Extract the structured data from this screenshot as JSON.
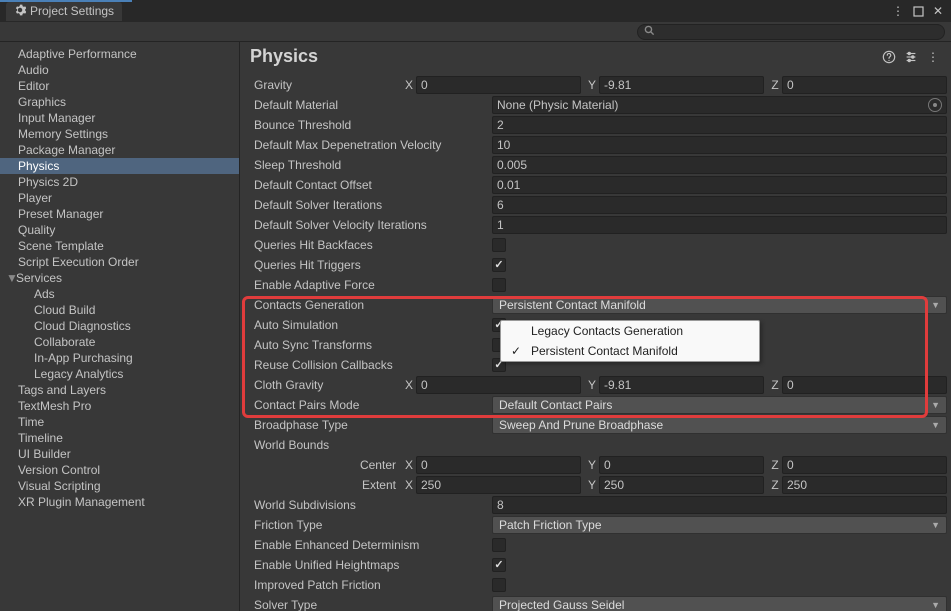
{
  "window": {
    "title": "Project Settings"
  },
  "search": {
    "placeholder": ""
  },
  "sidebar": {
    "items": [
      {
        "label": "Adaptive Performance"
      },
      {
        "label": "Audio"
      },
      {
        "label": "Editor"
      },
      {
        "label": "Graphics"
      },
      {
        "label": "Input Manager"
      },
      {
        "label": "Memory Settings"
      },
      {
        "label": "Package Manager"
      },
      {
        "label": "Physics",
        "selected": true
      },
      {
        "label": "Physics 2D"
      },
      {
        "label": "Player"
      },
      {
        "label": "Preset Manager"
      },
      {
        "label": "Quality"
      },
      {
        "label": "Scene Template"
      },
      {
        "label": "Script Execution Order"
      },
      {
        "label": "Services",
        "expandable": true,
        "expanded": true
      },
      {
        "label": "Ads",
        "indent": true
      },
      {
        "label": "Cloud Build",
        "indent": true
      },
      {
        "label": "Cloud Diagnostics",
        "indent": true
      },
      {
        "label": "Collaborate",
        "indent": true
      },
      {
        "label": "In-App Purchasing",
        "indent": true
      },
      {
        "label": "Legacy Analytics",
        "indent": true
      },
      {
        "label": "Tags and Layers"
      },
      {
        "label": "TextMesh Pro"
      },
      {
        "label": "Time"
      },
      {
        "label": "Timeline"
      },
      {
        "label": "UI Builder"
      },
      {
        "label": "Version Control"
      },
      {
        "label": "Visual Scripting"
      },
      {
        "label": "XR Plugin Management"
      }
    ]
  },
  "header": {
    "title": "Physics"
  },
  "labels": {
    "gravity": "Gravity",
    "defaultMaterial": "Default Material",
    "bounceThreshold": "Bounce Threshold",
    "defaultMaxDepen": "Default Max Depenetration Velocity",
    "sleepThreshold": "Sleep Threshold",
    "defaultContactOffset": "Default Contact Offset",
    "defaultSolverIterations": "Default Solver Iterations",
    "defaultSolverVelocityIterations": "Default Solver Velocity Iterations",
    "queriesHitBackfaces": "Queries Hit Backfaces",
    "queriesHitTriggers": "Queries Hit Triggers",
    "enableAdaptiveForce": "Enable Adaptive Force",
    "contactsGeneration": "Contacts Generation",
    "autoSimulation": "Auto Simulation",
    "autoSyncTransforms": "Auto Sync Transforms",
    "reuseCollisionCallbacks": "Reuse Collision Callbacks",
    "clothGravity": "Cloth Gravity",
    "contactPairsMode": "Contact Pairs Mode",
    "broadphaseType": "Broadphase Type",
    "worldBounds": "World Bounds",
    "center": "Center",
    "extent": "Extent",
    "worldSubdivisions": "World Subdivisions",
    "frictionType": "Friction Type",
    "enableEnhancedDeterminism": "Enable Enhanced Determinism",
    "enableUnifiedHeightmaps": "Enable Unified Heightmaps",
    "improvedPatchFriction": "Improved Patch Friction",
    "solverType": "Solver Type",
    "x": "X",
    "y": "Y",
    "z": "Z"
  },
  "values": {
    "gravity": {
      "x": "0",
      "y": "-9.81",
      "z": "0"
    },
    "defaultMaterial": "None (Physic Material)",
    "bounceThreshold": "2",
    "defaultMaxDepen": "10",
    "sleepThreshold": "0.005",
    "defaultContactOffset": "0.01",
    "defaultSolverIterations": "6",
    "defaultSolverVelocityIterations": "1",
    "queriesHitBackfaces": false,
    "queriesHitTriggers": true,
    "enableAdaptiveForce": false,
    "contactsGeneration": "Persistent Contact Manifold",
    "autoSimulation": true,
    "autoSyncTransforms": false,
    "reuseCollisionCallbacks": true,
    "clothGravity": {
      "x": "0",
      "y": "-9.81",
      "z": "0"
    },
    "contactPairsMode": "Default Contact Pairs",
    "broadphaseType": "Sweep And Prune Broadphase",
    "center": {
      "x": "0",
      "y": "0",
      "z": "0"
    },
    "extent": {
      "x": "250",
      "y": "250",
      "z": "250"
    },
    "worldSubdivisions": "8",
    "frictionType": "Patch Friction Type",
    "enableEnhancedDeterminism": false,
    "enableUnifiedHeightmaps": true,
    "improvedPatchFriction": false,
    "solverType": "Projected Gauss Seidel"
  },
  "dropdown": {
    "options": [
      {
        "label": "Legacy Contacts Generation",
        "checked": false
      },
      {
        "label": "Persistent Contact Manifold",
        "checked": true
      }
    ]
  }
}
